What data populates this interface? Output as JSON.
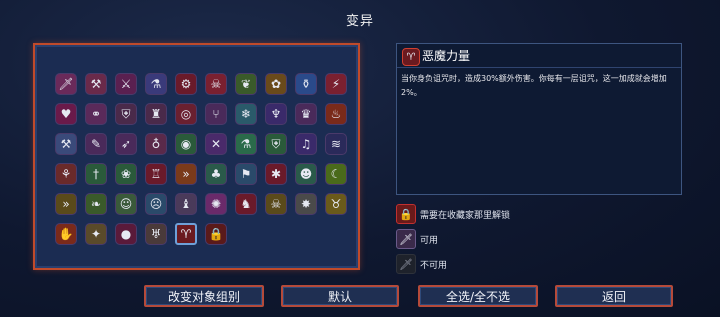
{
  "screen": {
    "title": "变异"
  },
  "mutation_grid": {
    "rows": [
      [
        {
          "icon": "sword-icon",
          "glyph": "🗡",
          "bg": "#6a2a5a"
        },
        {
          "icon": "pickaxe-icon",
          "glyph": "⚒",
          "bg": "#6a2a4a"
        },
        {
          "icon": "blade-icon",
          "glyph": "⚔",
          "bg": "#5a2050"
        },
        {
          "icon": "potion-icon",
          "glyph": "⚗",
          "bg": "#3a3a7a"
        },
        {
          "icon": "gear-icon",
          "glyph": "⚙",
          "bg": "#6a1a2a"
        },
        {
          "icon": "skull-icon",
          "glyph": "☠",
          "bg": "#7a2030"
        },
        {
          "icon": "frog-icon",
          "glyph": "❦",
          "bg": "#3a5a2a"
        },
        {
          "icon": "flower-icon",
          "glyph": "✿",
          "bg": "#6a4a1a"
        },
        {
          "icon": "jar-icon",
          "glyph": "⚱",
          "bg": "#2a4a8a"
        },
        {
          "icon": "lightning-icon",
          "glyph": "⚡",
          "bg": "#7a2030"
        }
      ],
      [
        {
          "icon": "heart-icon",
          "glyph": "♥",
          "bg": "#6a1a4a"
        },
        {
          "icon": "chain-icon",
          "glyph": "⚭",
          "bg": "#5a2a5a"
        },
        {
          "icon": "shield-icon",
          "glyph": "⛨",
          "bg": "#4a2a4a"
        },
        {
          "icon": "tower-icon",
          "glyph": "♜",
          "bg": "#4a2a4a"
        },
        {
          "icon": "target-icon",
          "glyph": "◎",
          "bg": "#6a2030"
        },
        {
          "icon": "fork-icon",
          "glyph": "⑂",
          "bg": "#4a2a5a"
        },
        {
          "icon": "snow-icon",
          "glyph": "❄",
          "bg": "#2a5a6a"
        },
        {
          "icon": "bat-icon",
          "glyph": "♆",
          "bg": "#3a2a6a"
        },
        {
          "icon": "crown-icon",
          "glyph": "♛",
          "bg": "#4a2a5a"
        },
        {
          "icon": "fire-icon",
          "glyph": "♨",
          "bg": "#7a2a1a"
        }
      ],
      [
        {
          "icon": "hammer-icon",
          "glyph": "⚒",
          "bg": "#3a4a7a"
        },
        {
          "icon": "scroll-icon",
          "glyph": "✎",
          "bg": "#4a2a5a"
        },
        {
          "icon": "arrow-icon",
          "glyph": "➶",
          "bg": "#4a2a5a"
        },
        {
          "icon": "lamp-icon",
          "glyph": "♁",
          "bg": "#5a2a4a"
        },
        {
          "icon": "eye-icon",
          "glyph": "◉",
          "bg": "#2a5a3a"
        },
        {
          "icon": "cross-blades-icon",
          "glyph": "✕",
          "bg": "#4a2a6a"
        },
        {
          "icon": "vial-icon",
          "glyph": "⚗",
          "bg": "#2a6a4a"
        },
        {
          "icon": "shield-green-icon",
          "glyph": "⛨",
          "bg": "#2a5a3a"
        },
        {
          "icon": "music-icon",
          "glyph": "♫",
          "bg": "#3a2a6a"
        },
        {
          "icon": "wind-icon",
          "glyph": "≋",
          "bg": "#2a2a5a"
        }
      ],
      [
        {
          "icon": "pouch-icon",
          "glyph": "⚘",
          "bg": "#6a2a2a"
        },
        {
          "icon": "dagger-icon",
          "glyph": "†",
          "bg": "#2a5a3a"
        },
        {
          "icon": "lotus-icon",
          "glyph": "❀",
          "bg": "#2a5a3a"
        },
        {
          "icon": "bottle-icon",
          "glyph": "♖",
          "bg": "#6a1a2a"
        },
        {
          "icon": "chevron-icon",
          "glyph": "»",
          "bg": "#7a3a1a"
        },
        {
          "icon": "plant-icon",
          "glyph": "♣",
          "bg": "#2a5a4a"
        },
        {
          "icon": "flag-icon",
          "glyph": "⚑",
          "bg": "#2a4a6a"
        },
        {
          "icon": "spider-icon",
          "glyph": "✱",
          "bg": "#6a1a2a"
        },
        {
          "icon": "cat-icon",
          "glyph": "☻",
          "bg": "#2a5a4a"
        },
        {
          "icon": "banana-icon",
          "glyph": "☾",
          "bg": "#4a6a1a"
        }
      ],
      [
        {
          "icon": "double-chevron-icon",
          "glyph": "»",
          "bg": "#5a4a1a"
        },
        {
          "icon": "leaf-icon",
          "glyph": "❧",
          "bg": "#3a5a2a"
        },
        {
          "icon": "mask-icon",
          "glyph": "☺",
          "bg": "#3a5a3a"
        },
        {
          "icon": "ghost-icon",
          "glyph": "☹",
          "bg": "#2a4a6a"
        },
        {
          "icon": "helmet-icon",
          "glyph": "♝",
          "bg": "#4a3a5a"
        },
        {
          "icon": "orb-icon",
          "glyph": "✺",
          "bg": "#6a2a6a"
        },
        {
          "icon": "totem-icon",
          "glyph": "♞",
          "bg": "#6a1a2a"
        },
        {
          "icon": "skull-gold-icon",
          "glyph": "☠",
          "bg": "#5a4a1a"
        },
        {
          "icon": "spikes-icon",
          "glyph": "✸",
          "bg": "#4a4a4a"
        },
        {
          "icon": "money-bag-icon",
          "glyph": "♉",
          "bg": "#6a5a1a"
        }
      ],
      [
        {
          "icon": "hand-fire-icon",
          "glyph": "✋",
          "bg": "#7a2a1a"
        },
        {
          "icon": "spark-icon",
          "glyph": "✦",
          "bg": "#5a4a2a"
        },
        {
          "icon": "berry-icon",
          "glyph": "●",
          "bg": "#5a1a3a"
        },
        {
          "icon": "cauldron-icon",
          "glyph": "♅",
          "bg": "#4a3a3a"
        },
        {
          "icon": "demon-icon",
          "glyph": "♈",
          "bg": "#6a1a20",
          "selected": true
        },
        {
          "icon": "lock-icon",
          "glyph": "🔒",
          "bg": "#5a1a1a"
        }
      ]
    ]
  },
  "detail": {
    "icon": "demon-power-icon",
    "title": "恶魔力量",
    "description": "当你身负诅咒时，造成30%额外伤害。你每有一层诅咒，这一加成就会增加2%。"
  },
  "legend": [
    {
      "icon": "lock-icon",
      "glyph": "🔒",
      "bg": "#6a1a1a",
      "label": "需要在收藏家那里解锁"
    },
    {
      "icon": "sword-enabled-icon",
      "glyph": "🗡",
      "bg": "#3a2a4a",
      "label": "可用"
    },
    {
      "icon": "sword-disabled-icon",
      "glyph": "🗡",
      "bg": "#2a2a2a",
      "label": "不可用"
    }
  ],
  "buttons": {
    "change_group": "改变对象组别",
    "default": "默认",
    "select_all": "全选/全不选",
    "back": "返回"
  },
  "colors": {
    "panel_border": "#c04a2a",
    "button_border": "#b54a3a",
    "selected_border": "#6fa0d8"
  }
}
